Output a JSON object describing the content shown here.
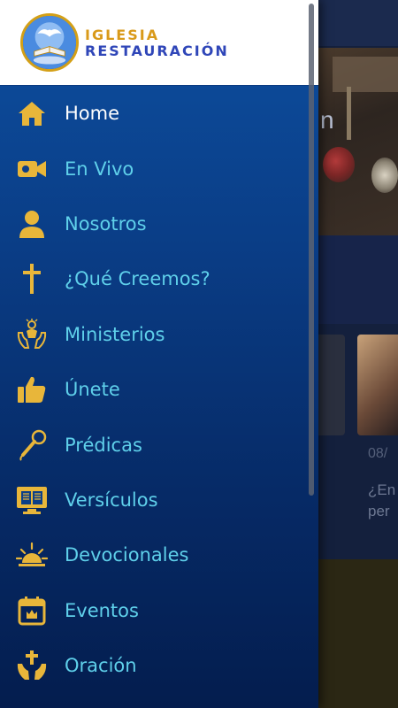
{
  "background": {
    "hero_partial_text": "n",
    "card_date_partial": "08/",
    "card_title_partial_line1": "¿En",
    "card_title_partial_line2": "per"
  },
  "drawer": {
    "brand": {
      "line1": "IGLESIA",
      "line2": "RESTAURACIÓN"
    },
    "items": [
      {
        "label": "Home",
        "icon": "home-icon",
        "active": true
      },
      {
        "label": "En Vivo",
        "icon": "video-camera-icon",
        "active": false
      },
      {
        "label": "Nosotros",
        "icon": "person-icon",
        "active": false
      },
      {
        "label": "¿Qué Creemos?",
        "icon": "cross-icon",
        "active": false
      },
      {
        "label": "Ministerios",
        "icon": "praying-hands-icon",
        "active": false
      },
      {
        "label": "Únete",
        "icon": "thumbs-up-icon",
        "active": false
      },
      {
        "label": "Prédicas",
        "icon": "microphone-icon",
        "active": false
      },
      {
        "label": "Versículos",
        "icon": "bible-monitor-icon",
        "active": false
      },
      {
        "label": "Devocionales",
        "icon": "sunrise-icon",
        "active": false
      },
      {
        "label": "Eventos",
        "icon": "calendar-icon",
        "active": false
      },
      {
        "label": "Oración",
        "icon": "prayer-cross-hands-icon",
        "active": false
      }
    ]
  },
  "colors": {
    "icon_gold": "#e8b63a",
    "label_cyan": "#5fd0ea",
    "label_active": "#ffffff",
    "brand_gold": "#d99a1a",
    "brand_blue": "#2f46b8"
  }
}
